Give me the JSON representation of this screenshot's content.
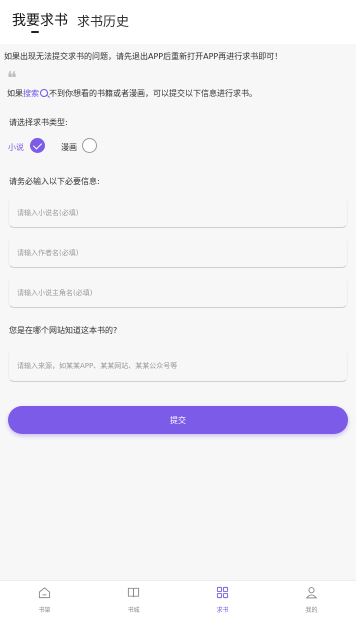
{
  "tabs": [
    {
      "label": "我要求书"
    },
    {
      "label": "求书历史"
    }
  ],
  "notice": "如果出现无法提交求书的问题，请先退出APP后重新打开APP再进行求书即可！",
  "hint": {
    "prefix": "如果",
    "link": "搜索",
    "suffix": "不到你想看的书籍或者漫画，可以提交以下信息进行求书。"
  },
  "type_section": {
    "label": "请选择求书类型:",
    "options": [
      {
        "label": "小说",
        "selected": true
      },
      {
        "label": "漫画",
        "selected": false
      }
    ]
  },
  "required_label": "请务必输入以下必要信息:",
  "fields": {
    "novel_name": {
      "placeholder": "请输入小说名(必填)",
      "value": ""
    },
    "author": {
      "placeholder": "请输入作者名(必填)",
      "value": ""
    },
    "main_character": {
      "placeholder": "请输入小说主角名(必填)",
      "value": ""
    }
  },
  "source_section": {
    "label": "您是在哪个网站知道这本书的?",
    "placeholder": "请输入来源，如某某APP、某某网站、某某公众号等",
    "value": ""
  },
  "submit_label": "提交",
  "colors": {
    "accent": "#7b5be8",
    "link": "#6f55e6",
    "background": "#f7f7f8"
  },
  "bottom_nav": [
    {
      "label": "书架",
      "icon": "home-icon",
      "active": false
    },
    {
      "label": "书城",
      "icon": "book-icon",
      "active": false
    },
    {
      "label": "求书",
      "icon": "grid-icon",
      "active": true
    },
    {
      "label": "我的",
      "icon": "user-icon",
      "active": false
    }
  ]
}
